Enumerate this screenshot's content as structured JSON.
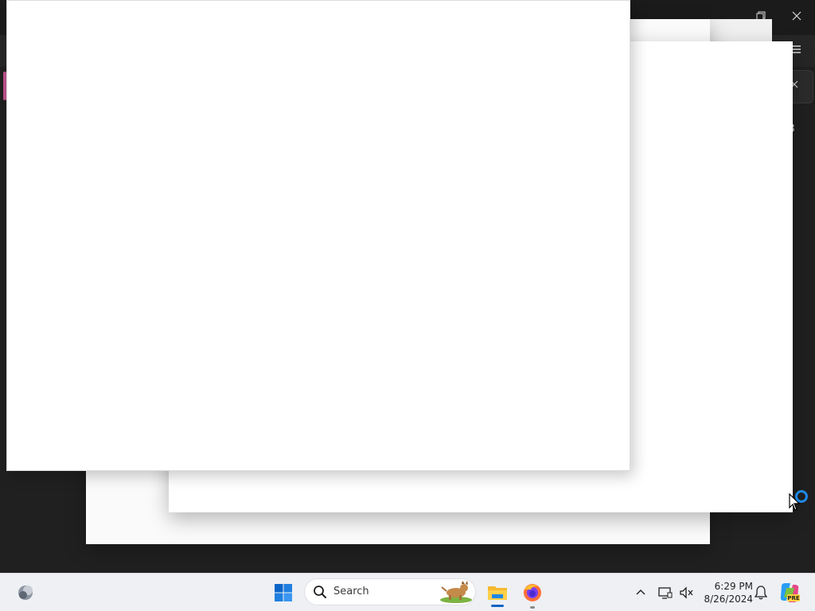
{
  "window": {
    "restore_icon": "restore-icon",
    "close_icon": "close-icon",
    "menu_icon": "hamburger-menu-icon",
    "tab_close_icon": "close-icon",
    "partial_text": "3",
    "accent_color": "#c2538d"
  },
  "taskbar": {
    "search_placeholder": "Search",
    "time": "6:29 PM",
    "date": "8/26/2024",
    "pinned": [
      "widgets-icon",
      "start-icon",
      "file-explorer-icon",
      "firefox-icon"
    ],
    "tray": [
      "chevron-up-icon",
      "network-icon",
      "volume-icon",
      "notification-bell-icon",
      "copilot-icon"
    ],
    "copilot_badge": "PRE"
  },
  "colors": {
    "taskbar_bg": "#eef0f3",
    "dark_bg": "#1f1f23",
    "windows_blue": "#0a64c8"
  }
}
